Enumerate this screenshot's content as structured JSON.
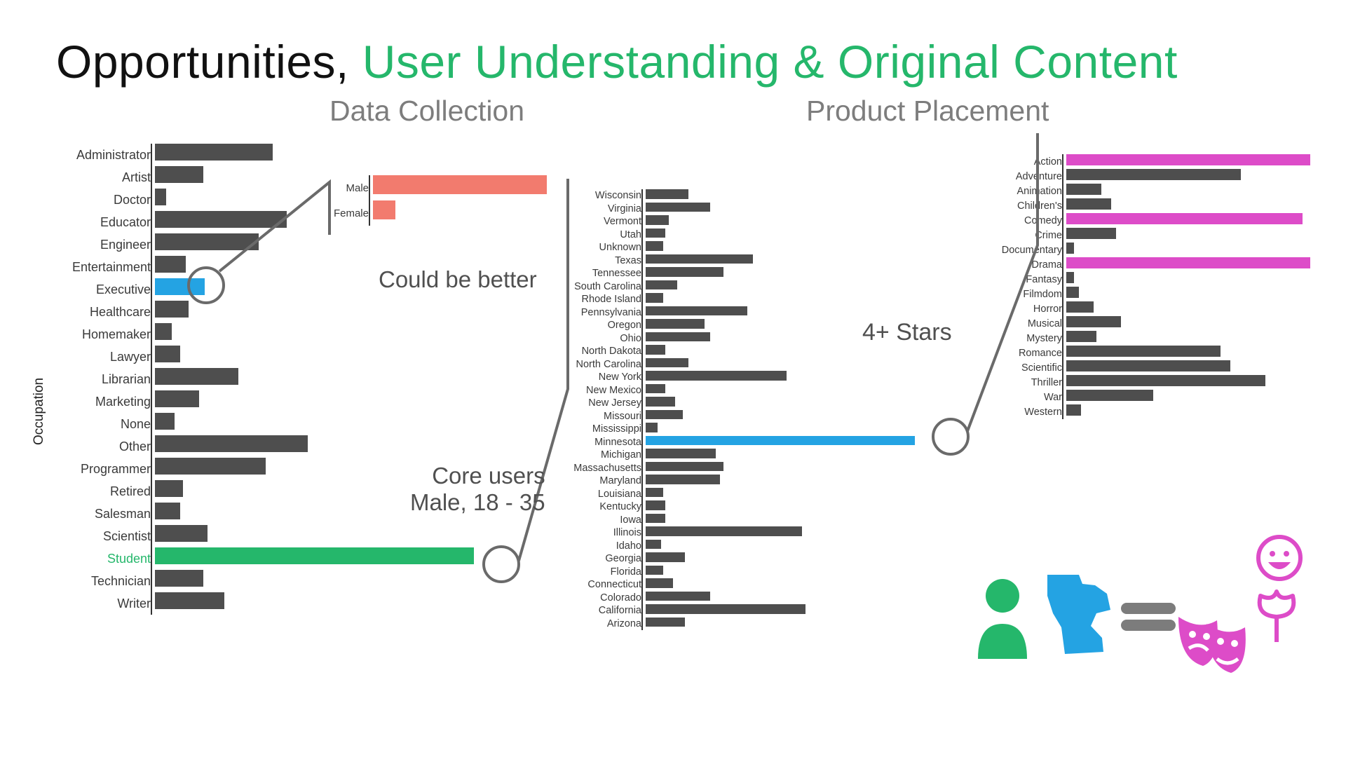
{
  "title_a": "Opportunities,",
  "title_b": "User Understanding & Original Content",
  "subtitle_data": "Data Collection",
  "subtitle_product": "Product Placement",
  "note_better": "Could be better",
  "note_core_users_l1": "Core users",
  "note_core_users_l2": "Male, 18 - 35",
  "note_stars": "4+ Stars",
  "colors": {
    "bar": "#4e4e4e",
    "highlight_green": "#25b76b",
    "highlight_blue": "#24a3e3",
    "highlight_magenta": "#dd4cc8",
    "highlight_salmon": "#f27b6e"
  },
  "ylabel_occupation": "Occupation",
  "chart_data": [
    {
      "type": "bar",
      "id": "occupation",
      "orientation": "horizontal",
      "ylabel": "Occupation",
      "max": 240,
      "categories": [
        "Administrator",
        "Artist",
        "Doctor",
        "Educator",
        "Engineer",
        "Entertainment",
        "Executive",
        "Healthcare",
        "Homemaker",
        "Lawyer",
        "Librarian",
        "Marketing",
        "None",
        "Other",
        "Programmer",
        "Retired",
        "Salesman",
        "Scientist",
        "Student",
        "Technician",
        "Writer"
      ],
      "values": [
        85,
        35,
        8,
        95,
        75,
        22,
        36,
        24,
        12,
        18,
        60,
        32,
        14,
        110,
        80,
        20,
        18,
        38,
        230,
        35,
        50
      ],
      "highlights": {
        "Executive": "highlight_blue",
        "Student": "highlight_green"
      }
    },
    {
      "type": "bar",
      "id": "gender",
      "orientation": "horizontal",
      "max": 100,
      "categories": [
        "Male",
        "Female"
      ],
      "values": [
        92,
        12
      ],
      "color": "highlight_salmon"
    },
    {
      "type": "bar",
      "id": "state",
      "orientation": "horizontal",
      "max": 140,
      "categories": [
        "Wisconsin",
        "Virginia",
        "Vermont",
        "Utah",
        "Unknown",
        "Texas",
        "Tennessee",
        "South Carolina",
        "Rhode Island",
        "Pennsylvania",
        "Oregon",
        "Ohio",
        "North Dakota",
        "North Carolina",
        "New York",
        "New Mexico",
        "New Jersey",
        "Missouri",
        "Mississippi",
        "Minnesota",
        "Michigan",
        "Massachusetts",
        "Maryland",
        "Louisiana",
        "Kentucky",
        "Iowa",
        "Illinois",
        "Idaho",
        "Georgia",
        "Florida",
        "Connecticut",
        "Colorado",
        "California",
        "Arizona"
      ],
      "values": [
        22,
        33,
        12,
        10,
        9,
        55,
        40,
        16,
        9,
        52,
        30,
        33,
        10,
        22,
        72,
        10,
        15,
        19,
        6,
        138,
        36,
        40,
        38,
        9,
        10,
        10,
        80,
        8,
        20,
        9,
        14,
        33,
        82,
        20
      ],
      "highlights": {
        "Minnesota": "highlight_blue"
      }
    },
    {
      "type": "bar",
      "id": "genre",
      "orientation": "horizontal",
      "title_callout": "4+ Stars",
      "max": 100,
      "categories": [
        "Action",
        "Adventure",
        "Animation",
        "Children's",
        "Comedy",
        "Crime",
        "Documentary",
        "Drama",
        "Fantasy",
        "Filmdom",
        "Horror",
        "Musical",
        "Mystery",
        "Romance",
        "Scientific",
        "Thriller",
        "War",
        "Western"
      ],
      "values": [
        98,
        70,
        14,
        18,
        95,
        20,
        3,
        98,
        3,
        5,
        11,
        22,
        12,
        62,
        66,
        80,
        35,
        6
      ],
      "highlights": {
        "Action": "highlight_magenta",
        "Comedy": "highlight_magenta",
        "Drama": "highlight_magenta"
      }
    }
  ]
}
